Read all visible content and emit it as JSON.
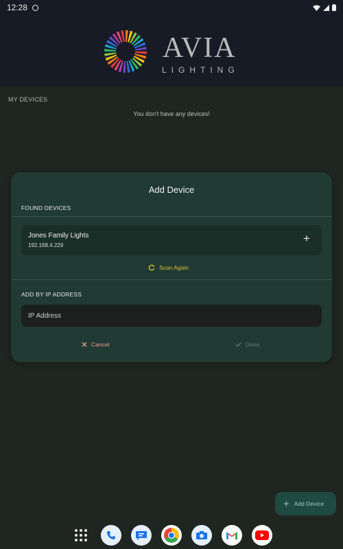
{
  "status_bar": {
    "time": "12:28"
  },
  "header": {
    "logo_title": "AVIA",
    "logo_subtitle": "LIGHTING"
  },
  "main": {
    "section_title": "MY DEVICES",
    "empty_message": "You don't have any devices!"
  },
  "dialog": {
    "title": "Add Device",
    "found_section": "FOUND DEVICES",
    "devices": [
      {
        "name": "Jones Family Lights",
        "ip": "192.168.4.229"
      }
    ],
    "scan_again_label": "Scan Again",
    "ip_section": "ADD BY IP ADDRESS",
    "ip_placeholder": "IP Address",
    "cancel_label": "Cancel",
    "done_label": "Done"
  },
  "fab": {
    "label": "Add Device"
  },
  "nav": {
    "apps": [
      "apps-icon",
      "phone-icon",
      "messages-icon",
      "chrome-icon",
      "camera-icon",
      "gmail-icon",
      "youtube-icon"
    ]
  },
  "colors": {
    "accent_yellow": "#d8c23a",
    "cancel_red": "#e89e97",
    "dialog_bg": "#213a33",
    "header_bg": "#171b26"
  }
}
